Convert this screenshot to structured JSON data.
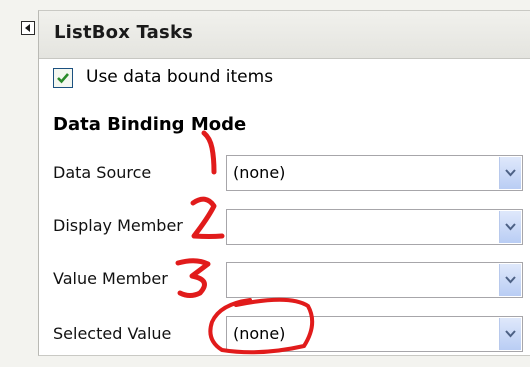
{
  "panel": {
    "title": "ListBox Tasks",
    "use_data_bound_items": {
      "label": "Use data bound items",
      "checked": true
    },
    "section_title": "Data Binding Mode",
    "rows": [
      {
        "label": "Data Source",
        "value": "(none)"
      },
      {
        "label": "Display Member",
        "value": ""
      },
      {
        "label": "Value Member",
        "value": ""
      },
      {
        "label": "Selected Value",
        "value": "(none)"
      }
    ]
  },
  "annotations": {
    "numbers": [
      "1",
      "2",
      "3"
    ],
    "color": "#e11b1b"
  },
  "icons": {
    "collapse": "collapse-left-icon",
    "checkbox": "check-mark-icon",
    "dropdown": "chevron-down-icon"
  },
  "colors": {
    "header_bg": "#e8e8e3",
    "combo_arrow": "#c9d8f7",
    "check_mark": "#2a8a2a"
  }
}
